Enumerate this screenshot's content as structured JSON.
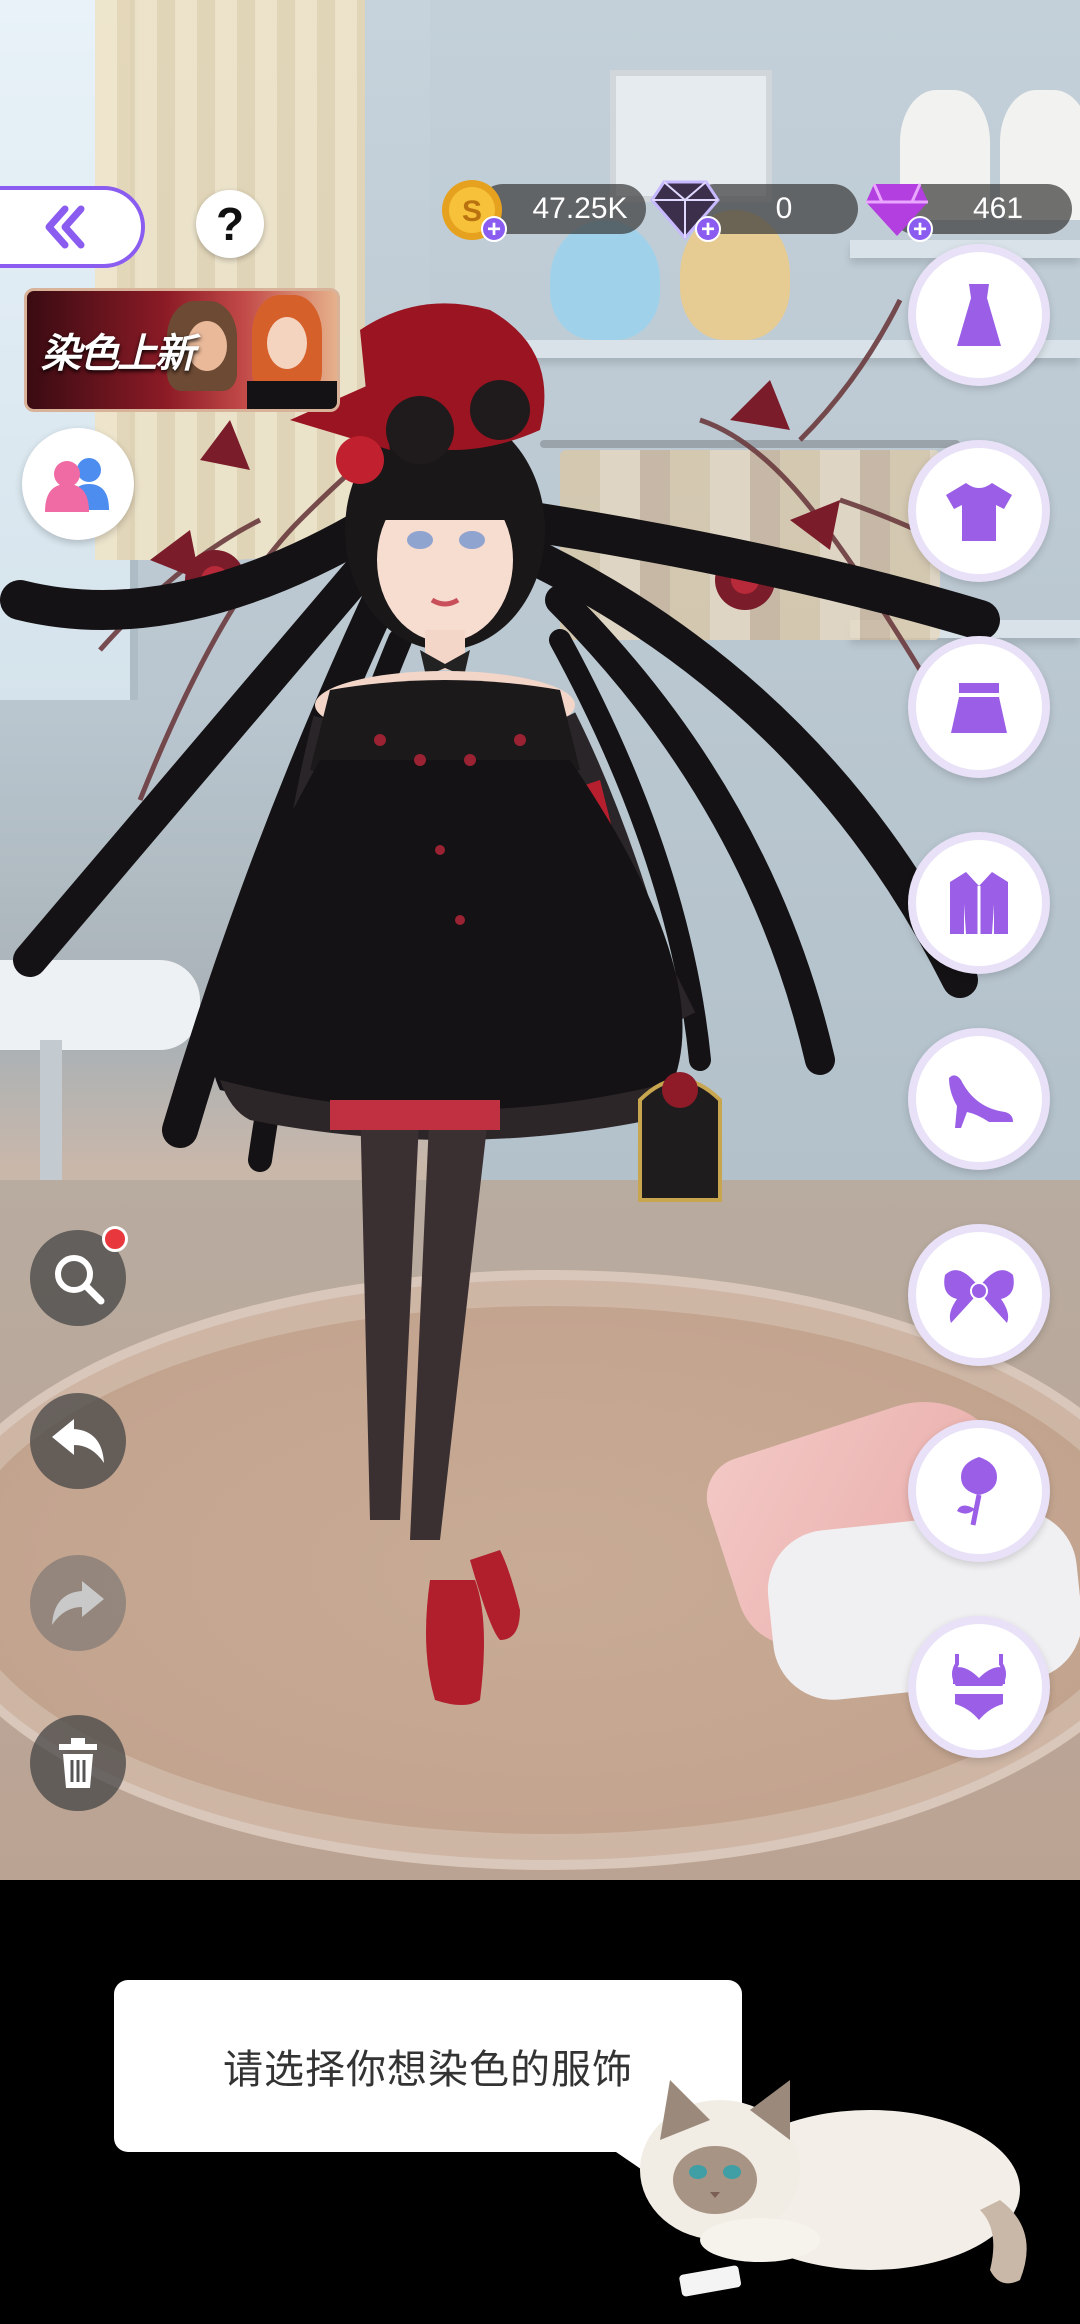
{
  "top_bar": {
    "back_button_icon": "double-chevron-left-icon",
    "help_label": "?",
    "currencies": [
      {
        "name": "gold",
        "icon": "gold-coin-icon",
        "value": "47.25K"
      },
      {
        "name": "diamond",
        "icon": "diamond-icon",
        "value": "0"
      },
      {
        "name": "gem",
        "icon": "purple-gem-icon",
        "value": "461"
      }
    ],
    "plus_symbol": "+"
  },
  "banner": {
    "text": "染色上新"
  },
  "friends_button": {
    "icon": "friends-icon"
  },
  "categories": [
    {
      "name": "dress",
      "icon": "dress-icon"
    },
    {
      "name": "top",
      "icon": "tshirt-icon"
    },
    {
      "name": "skirt",
      "icon": "skirt-icon"
    },
    {
      "name": "coat",
      "icon": "coat-icon"
    },
    {
      "name": "shoes",
      "icon": "high-heel-icon"
    },
    {
      "name": "accessory",
      "icon": "bow-icon"
    },
    {
      "name": "handheld",
      "icon": "rose-icon"
    },
    {
      "name": "lingerie",
      "icon": "lingerie-icon"
    }
  ],
  "side_tools": [
    {
      "name": "zoom",
      "icon": "magnifier-icon",
      "notification": true
    },
    {
      "name": "undo",
      "icon": "undo-icon"
    },
    {
      "name": "redo",
      "icon": "redo-icon",
      "disabled": true
    },
    {
      "name": "delete",
      "icon": "trash-icon"
    }
  ],
  "tutorial": {
    "message": "请选择你想染色的服饰"
  },
  "colors": {
    "accent": "#8a5cf0",
    "icon_purple": "#9a5fe6",
    "notification": "#e8383e"
  }
}
